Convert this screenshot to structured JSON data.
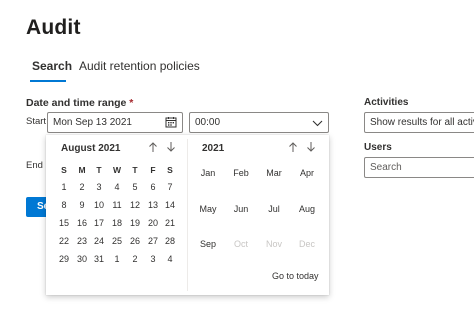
{
  "page": {
    "title": "Audit"
  },
  "tabs": [
    {
      "label": "Search",
      "active": true
    },
    {
      "label": "Audit retention policies",
      "active": false
    }
  ],
  "date_range": {
    "label": "Date and time range",
    "required_marker": "*",
    "start_label": "Start",
    "start_date": "Mon Sep 13 2021",
    "start_time": "00:00",
    "end_label": "End"
  },
  "activities": {
    "label": "Activities",
    "value": "Show results for all activities"
  },
  "users": {
    "label": "Users",
    "placeholder": "Search"
  },
  "search_button": {
    "label": "Search"
  },
  "calendar": {
    "month_title": "August 2021",
    "weekdays": [
      "S",
      "M",
      "T",
      "W",
      "T",
      "F",
      "S"
    ],
    "weeks": [
      [
        "1",
        "2",
        "3",
        "4",
        "5",
        "6",
        "7"
      ],
      [
        "8",
        "9",
        "10",
        "11",
        "12",
        "13",
        "14"
      ],
      [
        "15",
        "16",
        "17",
        "18",
        "19",
        "20",
        "21"
      ],
      [
        "22",
        "23",
        "24",
        "25",
        "26",
        "27",
        "28"
      ],
      [
        "29",
        "30",
        "31",
        "1",
        "2",
        "3",
        "4"
      ]
    ],
    "year_title": "2021",
    "months": [
      {
        "label": "Jan",
        "disabled": false
      },
      {
        "label": "Feb",
        "disabled": false
      },
      {
        "label": "Mar",
        "disabled": false
      },
      {
        "label": "Apr",
        "disabled": false
      },
      {
        "label": "May",
        "disabled": false
      },
      {
        "label": "Jun",
        "disabled": false
      },
      {
        "label": "Jul",
        "disabled": false
      },
      {
        "label": "Aug",
        "disabled": false
      },
      {
        "label": "Sep",
        "disabled": false
      },
      {
        "label": "Oct",
        "disabled": true
      },
      {
        "label": "Nov",
        "disabled": true
      },
      {
        "label": "Dec",
        "disabled": true
      }
    ],
    "goto_today": "Go to today"
  },
  "colors": {
    "accent": "#0078d4",
    "required": "#a4262c",
    "disabled_text": "#c8c6c4"
  }
}
